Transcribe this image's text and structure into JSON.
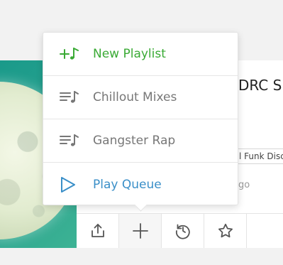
{
  "menu": {
    "items": [
      {
        "label": "New Playlist",
        "icon": "playlist-add-icon",
        "color": "#3aaa35"
      },
      {
        "label": "Chillout Mixes",
        "icon": "playlist-icon",
        "color": "#777777"
      },
      {
        "label": "Gangster Rap",
        "icon": "playlist-icon",
        "color": "#777777"
      },
      {
        "label": "Play Queue",
        "icon": "play-icon",
        "color": "#3a8fc8"
      }
    ]
  },
  "track": {
    "title": "DRC Sh",
    "genre": "l Funk Disc",
    "time": "go"
  },
  "actions": [
    {
      "icon": "share-icon"
    },
    {
      "icon": "add-icon"
    },
    {
      "icon": "history-icon"
    },
    {
      "icon": "star-icon"
    }
  ]
}
